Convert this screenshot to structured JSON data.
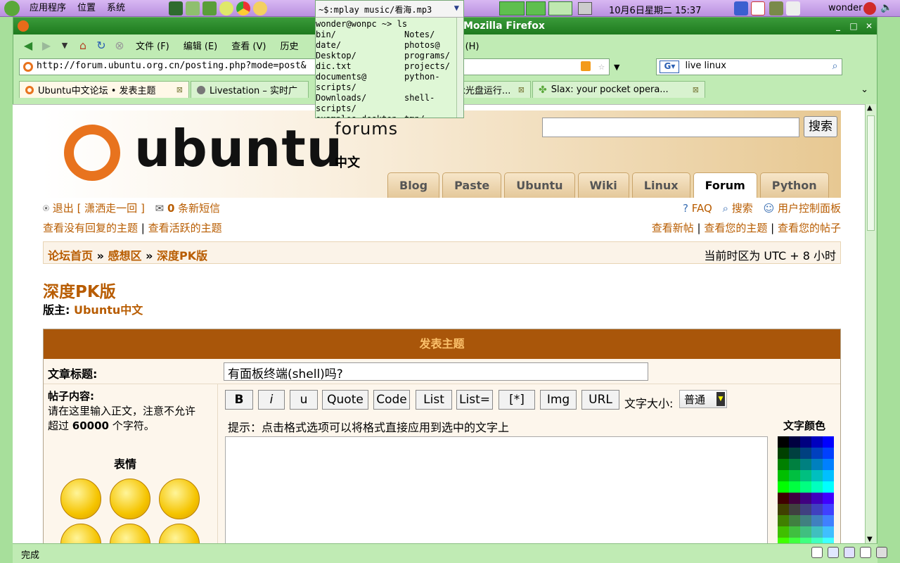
{
  "panel": {
    "menus": [
      "应用程序",
      "位置",
      "系统"
    ],
    "clock": "10月6日星期二 15:37",
    "user": "wonder"
  },
  "terminal": {
    "command": "~$:mplay music/看海.mp3",
    "prompt": "wonder@wonpc ~> ls",
    "lines": [
      [
        "bin/",
        "Notes/"
      ],
      [
        "date/",
        "photos@"
      ],
      [
        "Desktop/",
        "programs/"
      ],
      [
        "dic.txt",
        "projects/"
      ],
      [
        "documents@",
        "python-"
      ],
      [
        "scripts/",
        ""
      ],
      [
        "Downloads/",
        "shell-"
      ],
      [
        "scripts/",
        ""
      ],
      [
        "examples.desktop",
        "tmp/"
      ]
    ]
  },
  "firefox": {
    "title": "Mozilla Firefox",
    "menu": [
      "文件 (F)",
      "编辑 (E)",
      "查看 (V)",
      "历史",
      "助 (H)"
    ],
    "url": "http://forum.ubuntu.org.cn/posting.php?mode=post&",
    "search_query": "live linux",
    "tabs": [
      {
        "label": "Ubuntu中文论坛 • 发表主题",
        "active": true
      },
      {
        "label": "Livestation – 实时广",
        "active": false
      },
      {
        "label": "ux光盘运行...",
        "active": false
      },
      {
        "label": "Slax: your pocket opera...",
        "active": false
      }
    ],
    "status": "完成"
  },
  "site": {
    "logo_word": "ubuntu",
    "logo_forums": "forums",
    "logo_cn": "中文",
    "search_button": "搜索",
    "tabs": [
      "Blog",
      "Paste",
      "Ubuntu",
      "Wiki",
      "Linux",
      "Forum",
      "Python"
    ],
    "active_tab": "Forum",
    "logout": "退出 [ 潇洒走一回 ]",
    "new_messages_count": "0",
    "new_messages_label": "条新短信",
    "faq": "FAQ",
    "search": "搜索",
    "user_panel": "用户控制面板",
    "unanswered": "查看没有回复的主题",
    "active_topics": "查看活跃的主题",
    "new_posts": "查看新帖",
    "your_topics": "查看您的主题",
    "your_posts": "查看您的帖子",
    "breadcrumb": [
      "论坛首页",
      "感想区",
      "深度PK版"
    ],
    "timezone": "当前时区为 UTC + 8 小时",
    "forum_title": "深度PK版",
    "moderator_label": "版主:",
    "moderator": "Ubuntu中文"
  },
  "post_form": {
    "header": "发表主题",
    "subject_label": "文章标题:",
    "subject_value": "有面板终端(shell)吗?",
    "body_label": "帖子内容:",
    "body_desc_1": "请在这里输入正文，注意不允许",
    "body_desc_2": "超过",
    "body_limit": "60000",
    "body_desc_3": "个字符。",
    "smilies_label": "表情",
    "buttons": [
      "B",
      "i",
      "u",
      "Quote",
      "Code",
      "List",
      "List=",
      "[*]",
      "Img",
      "URL"
    ],
    "font_size_label": "文字大小:",
    "font_size_value": "普通",
    "hint": "提示：点击格式选项可以将格式直接应用到选中的文字上",
    "color_label": "文字颜色"
  },
  "palette_colors": [
    "#000000",
    "#000040",
    "#000080",
    "#0000bf",
    "#0000ff",
    "#004000",
    "#004040",
    "#004080",
    "#0040bf",
    "#0040ff",
    "#008000",
    "#008040",
    "#008080",
    "#0080bf",
    "#0080ff",
    "#00bf00",
    "#00bf40",
    "#00bf80",
    "#00bfbf",
    "#00bfff",
    "#00ff00",
    "#00ff40",
    "#00ff80",
    "#00ffbf",
    "#00ffff",
    "#400000",
    "#400040",
    "#400080",
    "#4000bf",
    "#4000ff",
    "#404000",
    "#404040",
    "#404080",
    "#4040bf",
    "#4040ff",
    "#408000",
    "#408040",
    "#408080",
    "#4080bf",
    "#4080ff",
    "#40bf00",
    "#40bf40",
    "#40bf80",
    "#40bfbf",
    "#40bfff",
    "#40ff00",
    "#40ff40",
    "#40ff80",
    "#40ffbf",
    "#40ffff"
  ]
}
